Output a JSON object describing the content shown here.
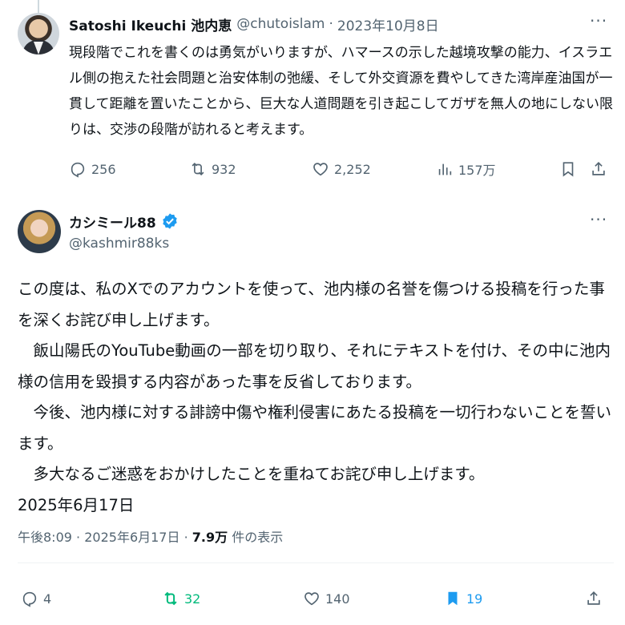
{
  "parent_tweet": {
    "name": "Satoshi Ikeuchi 池内恵",
    "handle": "@chutoislam",
    "separator": "·",
    "date": "2023年10月8日",
    "more_label": "···",
    "text": "現段階でこれを書くのは勇気がいりますが、ハマースの示した越境攻撃の能力、イスラエル側の抱えた社会問題と治安体制の弛緩、そして外交資源を費やしてきた湾岸産油国が一貫して距離を置いたことから、巨大な人道問題を引き起こしてガザを無人の地にしない限りは、交渉の段階が訪れると考えます。",
    "actions": {
      "replies": "256",
      "reposts": "932",
      "likes": "2,252",
      "views": "157万"
    }
  },
  "main_tweet": {
    "name": "カシミール88",
    "handle": "@kashmir88ks",
    "more_label": "···",
    "text": "この度は、私のXでのアカウントを使って、池内様の名誉を傷つける投稿を行った事を深くお詫び申し上げます。\n　飯山陽氏のYouTube動画の一部を切り取り、それにテキストを付け、その中に池内様の信用を毀損する内容があった事を反省しております。\n　今後、池内様に対する誹謗中傷や権利侵害にあたる投稿を一切行わないことを誓います。\n　多大なるご迷惑をおかけしたことを重ねてお詫び申し上げます。\n2025年6月17日",
    "meta": {
      "time": "午後8:09",
      "separator": "·",
      "date": "2025年6月17日",
      "views_count": "7.9万",
      "views_label": "件の表示"
    },
    "actions": {
      "replies": "4",
      "reposts": "32",
      "likes": "140",
      "bookmarks": "19"
    }
  },
  "colors": {
    "text": "#0f1419",
    "secondary": "#536471",
    "repost_active": "#00ba7c",
    "bookmark_active": "#1d9bf0",
    "verified": "#1d9bf0",
    "divider": "#eff3f4"
  }
}
